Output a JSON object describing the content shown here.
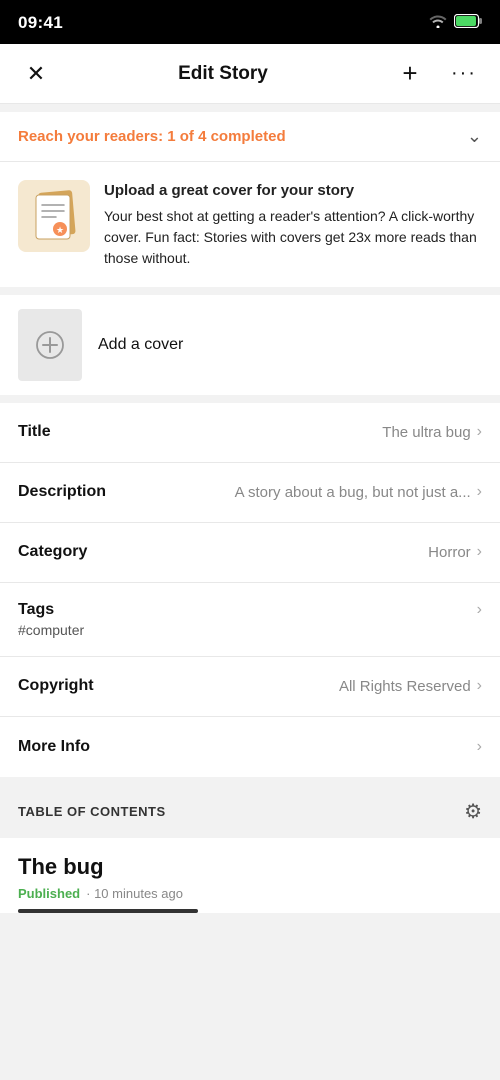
{
  "statusBar": {
    "time": "09:41",
    "wifi": true,
    "battery": true
  },
  "nav": {
    "title": "Edit Story",
    "closeLabel": "×",
    "addLabel": "+",
    "moreLabel": "···"
  },
  "reachBanner": {
    "label": "Reach your readers:",
    "progress": "1 of 4 completed"
  },
  "tipCard": {
    "headline": "Upload a great cover for your story",
    "body": "Your best shot at getting a reader's attention? A click-worthy cover. Fun fact: Stories with covers get 23x more reads than those without."
  },
  "addCover": {
    "label": "Add a cover"
  },
  "listItems": [
    {
      "label": "Title",
      "value": "The ultra bug",
      "id": "title"
    },
    {
      "label": "Description",
      "value": "A story about a bug, but not just a...",
      "id": "description"
    },
    {
      "label": "Category",
      "value": "Horror",
      "id": "category"
    },
    {
      "label": "Tags",
      "value": "",
      "tag": "#computer",
      "id": "tags"
    },
    {
      "label": "Copyright",
      "value": "All Rights Reserved",
      "id": "copyright"
    },
    {
      "label": "More Info",
      "value": "",
      "id": "more-info"
    }
  ],
  "tableOfContents": {
    "title": "TABLE OF CONTENTS"
  },
  "chapter": {
    "title": "The bug",
    "status": "Published",
    "time": "10 minutes ago"
  }
}
